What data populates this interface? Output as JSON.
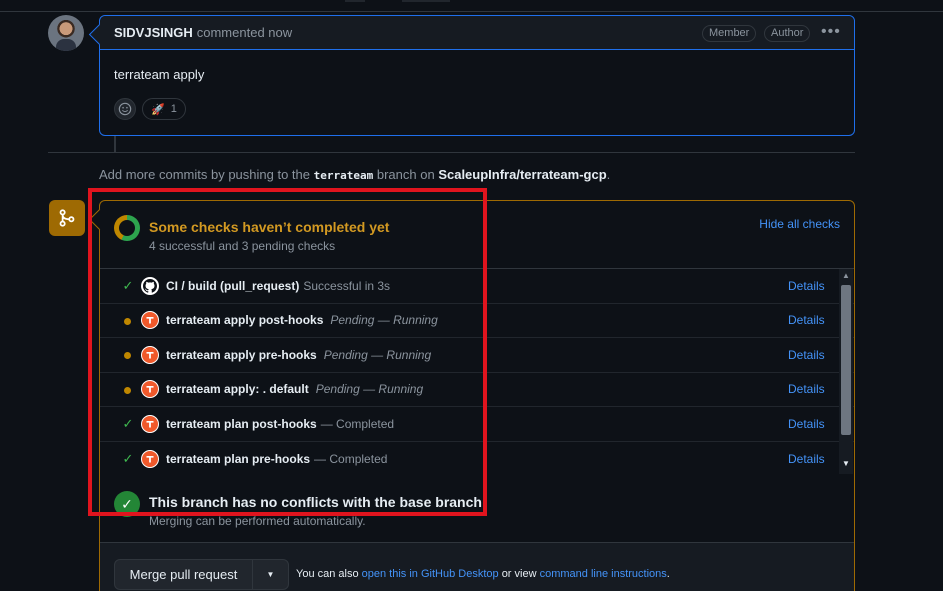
{
  "comment": {
    "author": "SIDVJSINGH",
    "action": "commented now",
    "badges": [
      "Member",
      "Author"
    ],
    "menu_icon": "kebab-horizontal-icon",
    "body": "terrateam apply",
    "reactions": {
      "rocket_count": "1"
    }
  },
  "push_note": {
    "prefix": "Add more commits by pushing to the",
    "branch": "terrateam",
    "middle": "branch on",
    "repo": "ScaleupInfra/terrateam-gcp",
    "suffix": "."
  },
  "checks": {
    "title": "Some checks haven’t completed yet",
    "subtitle": "4 successful and 3 pending checks",
    "hide_label": "Hide all checks",
    "details_label": "Details",
    "rows": [
      {
        "state": "success",
        "icon": "github-icon",
        "name": "CI / build (pull_request)",
        "status": "Successful in 3s",
        "italic": false
      },
      {
        "state": "pending",
        "icon": "terrateam-icon",
        "name": "terrateam apply post-hooks",
        "status": "Pending — Running",
        "italic": true
      },
      {
        "state": "pending",
        "icon": "terrateam-icon",
        "name": "terrateam apply pre-hooks",
        "status": "Pending — Running",
        "italic": true
      },
      {
        "state": "pending",
        "icon": "terrateam-icon",
        "name": "terrateam apply: . default",
        "status": "Pending — Running",
        "italic": true
      },
      {
        "state": "success",
        "icon": "terrateam-icon",
        "name": "terrateam plan post-hooks",
        "status": "— Completed",
        "italic": false
      },
      {
        "state": "success",
        "icon": "terrateam-icon",
        "name": "terrateam plan pre-hooks",
        "status": "— Completed",
        "italic": false
      }
    ]
  },
  "conflicts": {
    "title": "This branch has no conflicts with the base branch",
    "subtitle": "Merging can be performed automatically."
  },
  "merge": {
    "button_label": "Merge pull request",
    "also_text": "You can also",
    "link_desktop": "open this in GitHub Desktop",
    "or_view": "or view",
    "link_cli": "command line instructions",
    "end": "."
  },
  "colors": {
    "pending": "#d29922",
    "success": "#3fb950",
    "link": "#4493f8",
    "highlight": "#e0141e"
  }
}
